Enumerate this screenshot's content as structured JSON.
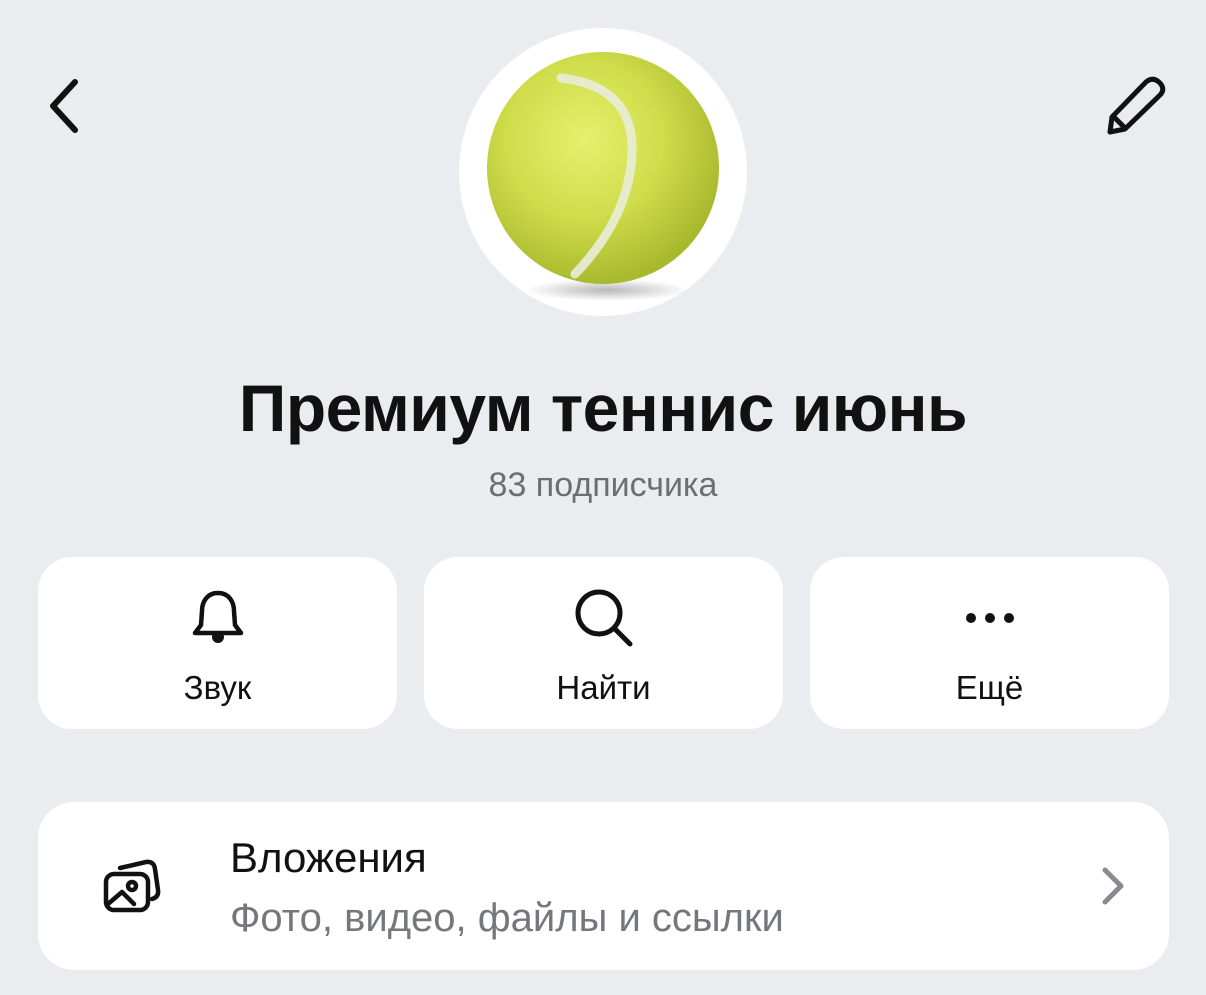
{
  "header": {
    "back_icon": "chevron-left-icon",
    "edit_icon": "pencil-icon"
  },
  "channel": {
    "avatar": "tennis-ball-image",
    "title": "Премиум теннис июнь",
    "subscribers": "83 подписчика"
  },
  "actions": [
    {
      "label": "Звук",
      "icon": "bell-icon"
    },
    {
      "label": "Найти",
      "icon": "search-icon"
    },
    {
      "label": "Ещё",
      "icon": "more-dots-icon"
    }
  ],
  "attachments": {
    "title": "Вложения",
    "subtitle": "Фото, видео, файлы и ссылки",
    "icon": "media-gallery-icon",
    "chevron": "chevron-right-icon"
  },
  "colors": {
    "background": "#ebecf0",
    "card": "#ffffff",
    "text_primary": "#111111",
    "text_secondary": "#6d6e73",
    "tennis_ball": "#d4e157"
  }
}
